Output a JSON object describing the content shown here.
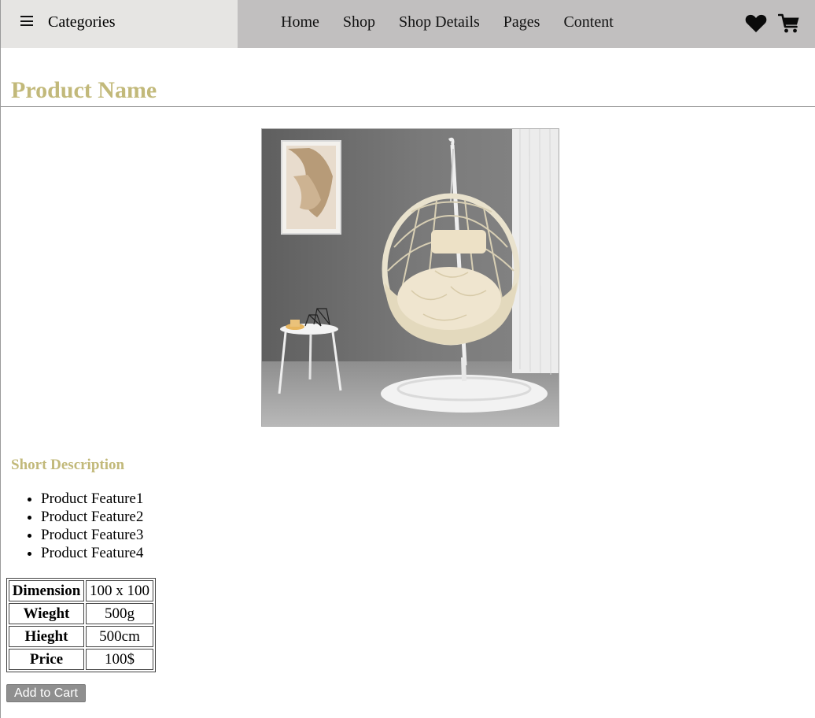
{
  "nav": {
    "categories_label": "Categories",
    "links": [
      "Home",
      "Shop",
      "Shop Details",
      "Pages",
      "Content"
    ],
    "icons": {
      "menu": "hamburger-menu-icon",
      "wishlist": "heart-icon",
      "cart": "shopping-cart-icon"
    }
  },
  "product": {
    "name": "Product Name",
    "image": "hanging-egg-chair-photo",
    "short_description_heading": "Short Description",
    "features": [
      "Product Feature1",
      "Product Feature2",
      "Product Feature3",
      "Product Feature4"
    ],
    "specs": [
      {
        "key": "Dimension",
        "value": "100 x 100"
      },
      {
        "key": "Wieght",
        "value": "500g"
      },
      {
        "key": "Hieght",
        "value": "500cm"
      },
      {
        "key": "Price",
        "value": "100$"
      }
    ],
    "add_to_cart_label": "Add to Cart"
  },
  "colors": {
    "nav_bg": "#c1bfbf",
    "categories_bg": "#e6e5e3",
    "heading_accent": "#c2b97a",
    "button_bg": "#8f8f8f"
  }
}
